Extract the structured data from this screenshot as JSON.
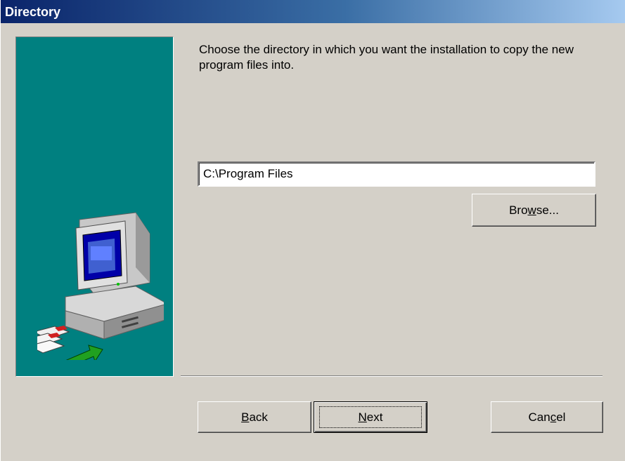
{
  "window": {
    "title": "Directory"
  },
  "instructions": "Choose the directory in which you want the installation to copy the new program files into.",
  "destination": {
    "value": "C:\\Program Files"
  },
  "buttons": {
    "browse": {
      "pre": "Bro",
      "mnemonic": "w",
      "post": "se..."
    },
    "back": {
      "pre": "",
      "mnemonic": "B",
      "post": "ack"
    },
    "next": {
      "pre": "",
      "mnemonic": "N",
      "post": "ext"
    },
    "cancel": {
      "pre": "Can",
      "mnemonic": "c",
      "post": "el"
    }
  },
  "colors": {
    "title_bar_start": "#0a246a",
    "title_bar_end": "#a6caf0",
    "side_panel": "#008080",
    "face": "#d4d0c8"
  },
  "icons": {
    "side_panel_art": "computer-with-floppy-disks-and-arrow"
  }
}
